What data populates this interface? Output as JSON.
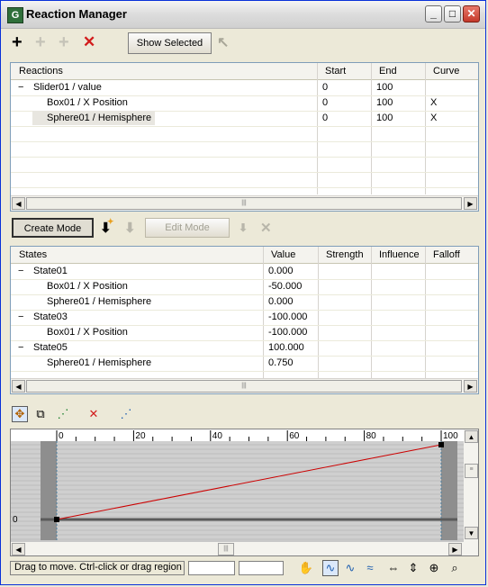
{
  "window": {
    "title": "Reaction Manager",
    "app_icon": "G",
    "minimize": "_",
    "maximize": "□",
    "close": "✕"
  },
  "toolbar": {
    "show_selected_label": "Show Selected"
  },
  "reactions": {
    "columns": [
      "Reactions",
      "Start",
      "End",
      "Curve"
    ],
    "rows": [
      {
        "expander": "−",
        "name": "Slider01 / value",
        "start": "0",
        "end": "100",
        "curve": ""
      },
      {
        "expander": "",
        "name": "Box01 / X Position",
        "start": "0",
        "end": "100",
        "curve": "X"
      },
      {
        "expander": "",
        "name": "Sphere01 / Hemisphere",
        "start": "0",
        "end": "100",
        "curve": "X"
      }
    ]
  },
  "mode_toolbar": {
    "create_mode_label": "Create Mode",
    "edit_mode_label": "Edit Mode"
  },
  "states": {
    "columns": [
      "States",
      "Value",
      "Strength",
      "Influence",
      "Falloff"
    ],
    "rows": [
      {
        "expander": "−",
        "name": "State01",
        "value": "0.000"
      },
      {
        "expander": "",
        "name": "Box01 / X Position",
        "value": "-50.000"
      },
      {
        "expander": "",
        "name": "Sphere01 / Hemisphere",
        "value": "0.000"
      },
      {
        "expander": "−",
        "name": "State03",
        "value": "-100.000"
      },
      {
        "expander": "",
        "name": "Box01 / X Position",
        "value": "-100.000"
      },
      {
        "expander": "−",
        "name": "State05",
        "value": "100.000"
      },
      {
        "expander": "",
        "name": "Sphere01 / Hemisphere",
        "value": "0.750"
      }
    ]
  },
  "curve_editor": {
    "ruler_labels": [
      "0",
      "20",
      "40",
      "60",
      "80",
      "100"
    ],
    "y_label": "0",
    "curve_color": "#cc0000"
  },
  "status": {
    "message": "Drag to move. Ctrl-click or drag region"
  }
}
